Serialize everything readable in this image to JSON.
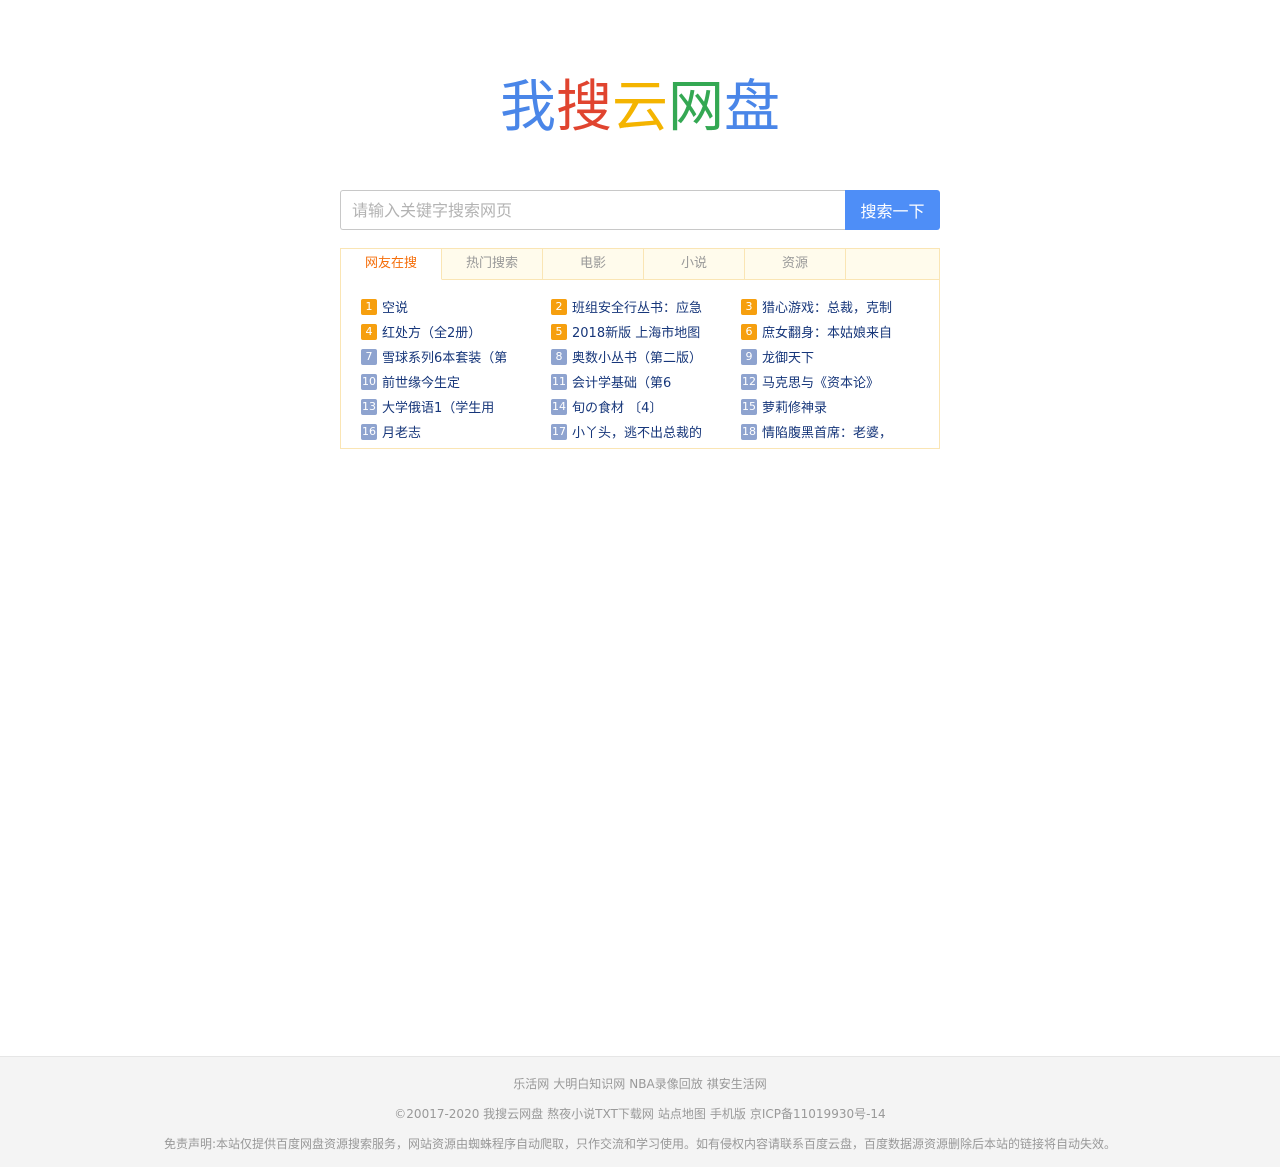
{
  "logo": {
    "chars": [
      {
        "text": "我",
        "color": "#4a86e8"
      },
      {
        "text": "搜",
        "color": "#e0442f"
      },
      {
        "text": "云",
        "color": "#f4b400"
      },
      {
        "text": "网",
        "color": "#34a853"
      },
      {
        "text": "盘",
        "color": "#4a86e8"
      }
    ]
  },
  "search": {
    "placeholder": "请输入关键字搜索网页",
    "value": "",
    "button_label": "搜索一下"
  },
  "tabs": [
    {
      "label": "网友在搜",
      "active": true
    },
    {
      "label": "热门搜索",
      "active": false
    },
    {
      "label": "电影",
      "active": false
    },
    {
      "label": "小说",
      "active": false
    },
    {
      "label": "资源",
      "active": false
    }
  ],
  "hot_items": [
    {
      "num": "1",
      "text": "空说",
      "color": "#f69f0e"
    },
    {
      "num": "2",
      "text": "班组安全行丛书：应急",
      "color": "#f69f0e"
    },
    {
      "num": "3",
      "text": "猎心游戏：总裁，克制",
      "color": "#f69f0e"
    },
    {
      "num": "4",
      "text": "红处方（全2册）",
      "color": "#f69f0e"
    },
    {
      "num": "5",
      "text": "2018新版 上海市地图",
      "color": "#f69f0e"
    },
    {
      "num": "6",
      "text": "庶女翻身：本姑娘来自",
      "color": "#f69f0e"
    },
    {
      "num": "7",
      "text": "雪球系列6本套装（第",
      "color": "#8ea3cf"
    },
    {
      "num": "8",
      "text": "奥数小丛书（第二版）",
      "color": "#8ea3cf"
    },
    {
      "num": "9",
      "text": "龙御天下",
      "color": "#8ea3cf"
    },
    {
      "num": "10",
      "text": "前世缘今生定",
      "color": "#8ea3cf"
    },
    {
      "num": "11",
      "text": "会计学基础（第6",
      "color": "#8ea3cf"
    },
    {
      "num": "12",
      "text": "马克思与《资本论》",
      "color": "#8ea3cf"
    },
    {
      "num": "13",
      "text": "大学俄语1（学生用",
      "color": "#8ea3cf"
    },
    {
      "num": "14",
      "text": "旬の食材 〔4〕",
      "color": "#8ea3cf"
    },
    {
      "num": "15",
      "text": "萝莉修神录",
      "color": "#8ea3cf"
    },
    {
      "num": "16",
      "text": "月老志",
      "color": "#8ea3cf"
    },
    {
      "num": "17",
      "text": "小丫头，逃不出总裁的",
      "color": "#8ea3cf"
    },
    {
      "num": "18",
      "text": "情陷腹黑首席：老婆，",
      "color": "#8ea3cf"
    }
  ],
  "footer": {
    "links": [
      "乐活网",
      "大明白知识网",
      "NBA录像回放",
      "祺安生活网"
    ],
    "copyright_items": [
      "©20017-2020 我搜云网盘",
      "熬夜小说TXT下载网",
      "站点地图",
      "手机版",
      "京ICP备11019930号-14"
    ],
    "disclaimer": "免责声明:本站仅提供百度网盘资源搜索服务，网站资源由蜘蛛程序自动爬取，只作交流和学习使用。如有侵权内容请联系百度云盘，百度数据源资源删除后本站的链接将自动失效。"
  }
}
